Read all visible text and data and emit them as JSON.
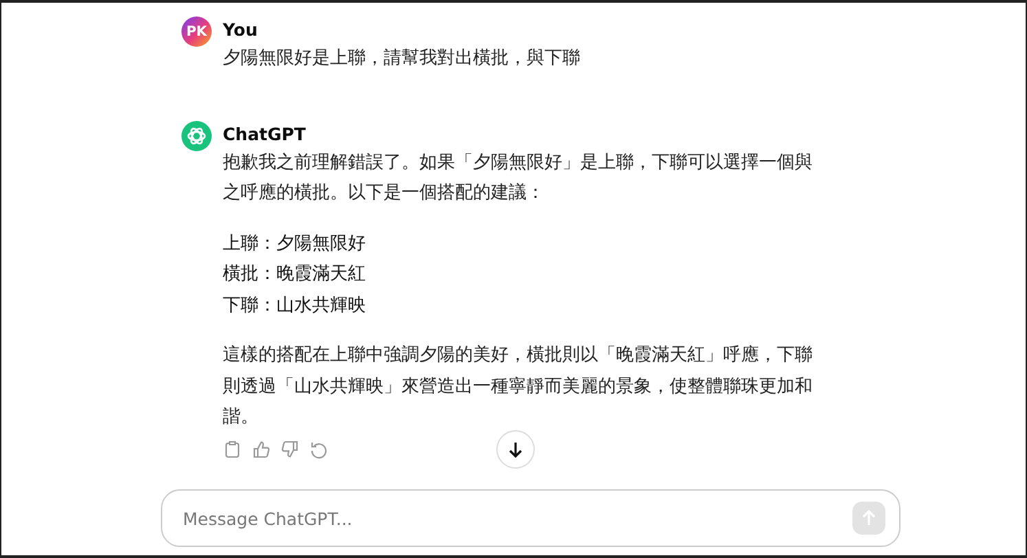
{
  "messages": [
    {
      "kind": "user",
      "author": "You",
      "avatar_text": "PK",
      "paragraphs": [
        "夕陽無限好是上聯，請幫我對出橫批，與下聯"
      ]
    },
    {
      "kind": "assistant",
      "author": "ChatGPT",
      "paragraphs": [
        "抱歉我之前理解錯誤了。如果「夕陽無限好」是上聯，下聯可以選擇一個與之呼應的橫批。以下是一個搭配的建議：",
        {
          "kind": "list",
          "items": [
            "上聯：夕陽無限好",
            "橫批：晚霞滿天紅",
            "下聯：山水共輝映"
          ]
        },
        "這樣的搭配在上聯中強調夕陽的美好，橫批則以「晚霞滿天紅」呼應，下聯則透過「山水共輝映」來營造出一種寧靜而美麗的景象，使整體聯珠更加和諧。"
      ]
    }
  ],
  "composer": {
    "placeholder": "Message ChatGPT...",
    "send_disabled": true
  }
}
